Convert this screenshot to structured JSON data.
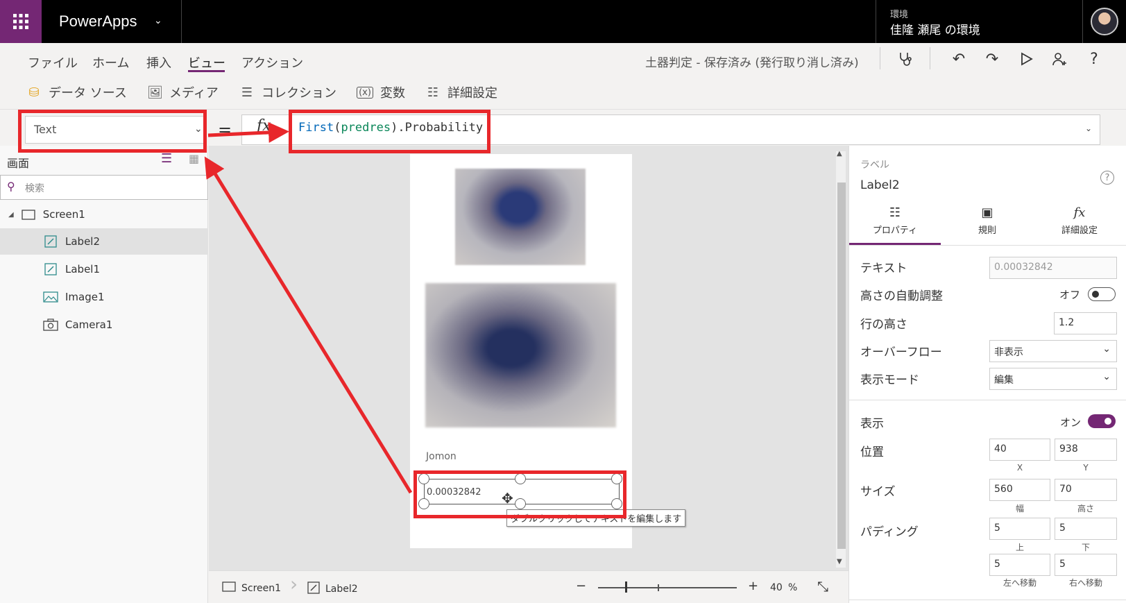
{
  "app": {
    "name": "PowerApps"
  },
  "environment": {
    "label": "環境",
    "name": "佳隆 瀬尾 の環境"
  },
  "menu": {
    "file": "ファイル",
    "home": "ホーム",
    "insert": "挿入",
    "view": "ビュー",
    "action": "アクション",
    "doc_status": "土器判定 - 保存済み (発行取り消し済み)"
  },
  "ribbon": {
    "data_source": "データ ソース",
    "media": "メディア",
    "collection": "コレクション",
    "variables": "変数",
    "advanced": "詳細設定"
  },
  "formula_bar": {
    "property": "Text",
    "equals": "=",
    "fx": "fx",
    "formula_fn": "First",
    "formula_open": "(",
    "formula_arg": "predres",
    "formula_close": ").Probability"
  },
  "tree": {
    "title": "画面",
    "search_placeholder": "検索",
    "nodes": [
      {
        "label": "Screen1",
        "icon": "screen-icon"
      },
      {
        "label": "Label2",
        "icon": "label-icon"
      },
      {
        "label": "Label1",
        "icon": "label-icon"
      },
      {
        "label": "Image1",
        "icon": "image-icon"
      },
      {
        "label": "Camera1",
        "icon": "camera-icon"
      }
    ]
  },
  "canvas": {
    "label_jomon": "Jomon",
    "label_probability": "0.00032842",
    "tooltip": "ダブルクリックしてテキストを編集します"
  },
  "statusbar": {
    "screen": "Screen1",
    "control": "Label2",
    "zoom_minus": "−",
    "zoom_plus": "+",
    "zoom_value": "40",
    "zoom_unit": "%"
  },
  "props_panel": {
    "kind": "ラベル",
    "name": "Label2",
    "tabs": {
      "properties": "プロパティ",
      "rules": "規則",
      "advanced": "詳細設定"
    },
    "text_label": "テキスト",
    "text_value": "0.00032842",
    "autoheight_label": "高さの自動調整",
    "autoheight_state": "オフ",
    "lineheight_label": "行の高さ",
    "lineheight_value": "1.2",
    "overflow_label": "オーバーフロー",
    "overflow_value": "非表示",
    "mode_label": "表示モード",
    "mode_value": "編集",
    "visible_label": "表示",
    "visible_state": "オン",
    "position_label": "位置",
    "pos_x": "40",
    "pos_y": "938",
    "x_label": "X",
    "y_label": "Y",
    "size_label": "サイズ",
    "width": "560",
    "height": "70",
    "width_label": "幅",
    "height_label": "高さ",
    "padding_label": "パディング",
    "pad_top": "5",
    "pad_bottom": "5",
    "pad_left": "5",
    "pad_right": "5",
    "pad_top_label": "上",
    "pad_bottom_label": "下",
    "pad_left_label": "左へ移動",
    "pad_right_label": "右へ移動"
  },
  "colors": {
    "accent": "#742774",
    "annotation": "#e8272b"
  }
}
